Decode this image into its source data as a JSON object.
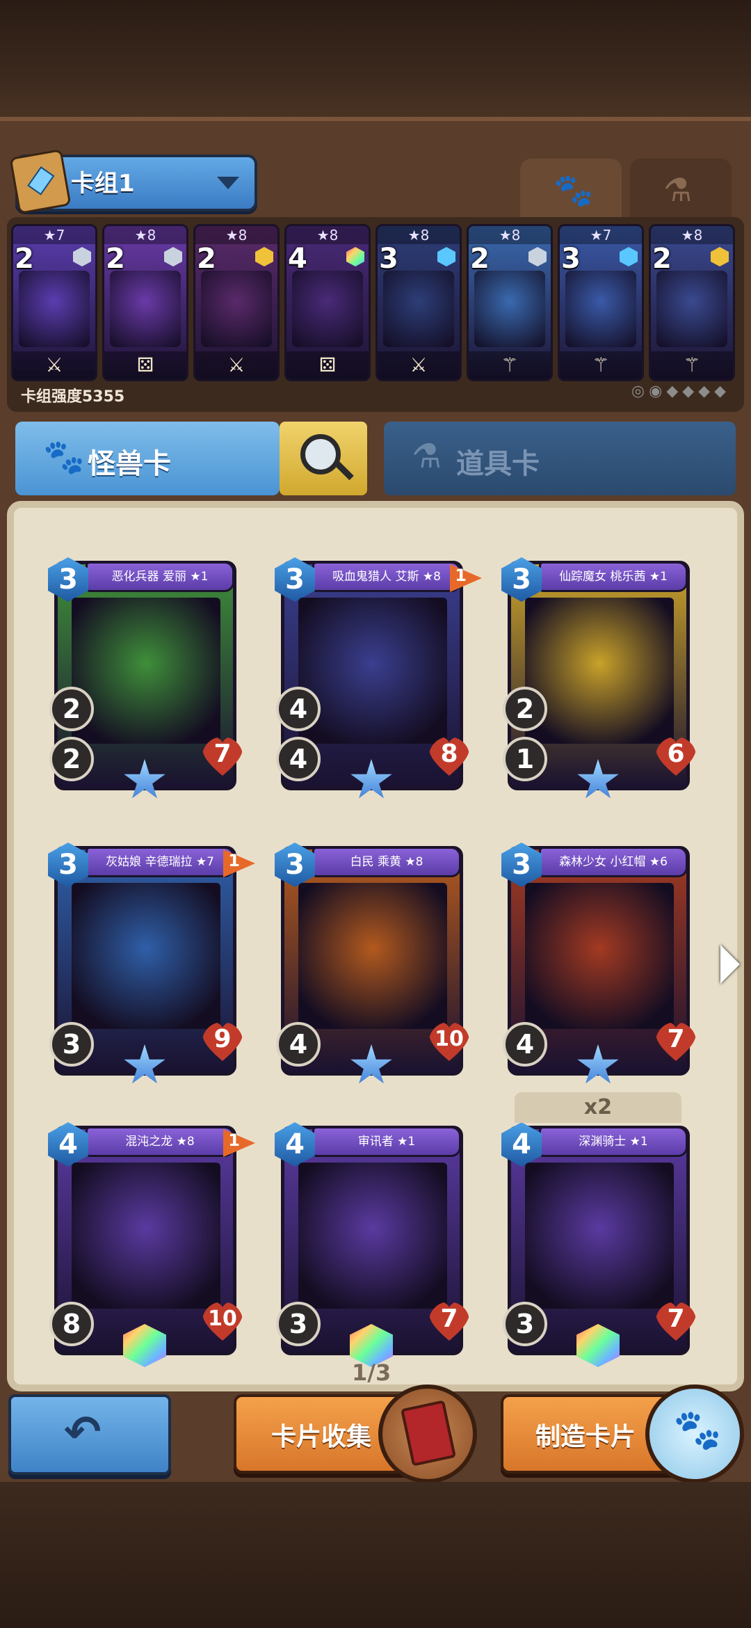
{
  "deck": {
    "name": "卡组1",
    "power_label": "卡组强度5355",
    "cards": [
      {
        "stars": "★7",
        "cost": "2",
        "gem": "silver",
        "color": "#5b3db0",
        "icon": "sword-icon",
        "symbol": "⚔"
      },
      {
        "stars": "★8",
        "cost": "2",
        "gem": "silver",
        "color": "#6a3aa8",
        "icon": "dice-icon",
        "symbol": "⚄"
      },
      {
        "stars": "★8",
        "cost": "2",
        "gem": "gold",
        "color": "#5a2a6a",
        "icon": "sword-icon",
        "symbol": "⚔"
      },
      {
        "stars": "★8",
        "cost": "4",
        "gem": "prism",
        "color": "#4a2a78",
        "icon": "dice-icon",
        "symbol": "⚄"
      },
      {
        "stars": "★8",
        "cost": "3",
        "gem": "blue",
        "color": "#2d3e78",
        "icon": "sword-staff-icon",
        "symbol": "⚔"
      },
      {
        "stars": "★8",
        "cost": "2",
        "gem": "silver",
        "color": "#3a6ab0",
        "icon": "staff-icon",
        "symbol": "⚚"
      },
      {
        "stars": "★7",
        "cost": "3",
        "gem": "blue",
        "color": "#3a5aa8",
        "icon": "staff-icon",
        "symbol": "⚚"
      },
      {
        "stars": "★8",
        "cost": "2",
        "gem": "gold",
        "color": "#3a4a90",
        "icon": "staff-icon",
        "symbol": "⚚"
      }
    ]
  },
  "tabs": {
    "monster": "怪兽卡",
    "item": "道具卡"
  },
  "cards": [
    {
      "name": "恶化兵器 爱丽 ★1",
      "cost": "3",
      "atk": "2",
      "def": "2",
      "hp": "7",
      "flag": "",
      "emblem": "star",
      "frame": "#3f8f3a"
    },
    {
      "name": "吸血鬼猎人 艾斯 ★8",
      "cost": "3",
      "atk": "4",
      "def": "4",
      "hp": "8",
      "flag": "1",
      "emblem": "star",
      "frame": "#3a3f8f"
    },
    {
      "name": "仙踪魔女 桃乐茜 ★1",
      "cost": "3",
      "atk": "2",
      "def": "1",
      "hp": "6",
      "flag": "",
      "emblem": "star",
      "frame": "#c9a22a"
    },
    {
      "name": "灰姑娘 辛德瑞拉 ★7",
      "cost": "3",
      "atk": "",
      "def": "3",
      "hp": "9",
      "flag": "1",
      "emblem": "star",
      "frame": "#2f5fa8"
    },
    {
      "name": "白民 乘黄 ★8",
      "cost": "3",
      "atk": "",
      "def": "4",
      "hp": "10",
      "flag": "",
      "emblem": "star",
      "frame": "#b35a1e"
    },
    {
      "name": "森林少女 小红帽 ★6",
      "cost": "3",
      "atk": "",
      "def": "4",
      "hp": "7",
      "flag": "",
      "emblem": "star",
      "frame": "#a33a22"
    },
    {
      "name": "混沌之龙 ★8",
      "cost": "4",
      "atk": "",
      "def": "8",
      "hp": "10",
      "flag": "1",
      "emblem": "prism",
      "frame": "#5a3aa0"
    },
    {
      "name": "审讯者 ★1",
      "cost": "4",
      "atk": "",
      "def": "3",
      "hp": "7",
      "flag": "",
      "emblem": "prism",
      "frame": "#5a3aa0"
    },
    {
      "name": "深渊骑士 ★1",
      "cost": "4",
      "atk": "",
      "def": "3",
      "hp": "7",
      "flag": "",
      "emblem": "prism",
      "frame": "#5a3aa0"
    }
  ],
  "extra": {
    "count": "x2",
    "page": "1/3"
  },
  "buttons": {
    "collect": "卡片收集",
    "craft": "制造卡片"
  }
}
